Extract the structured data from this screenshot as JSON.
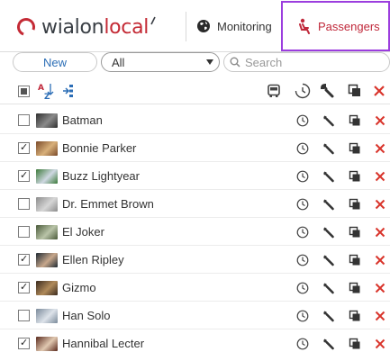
{
  "header": {
    "logo_prefix": "wialon",
    "logo_suffix": "local",
    "nav": [
      {
        "label": "Monitoring",
        "icon": "globe-icon"
      },
      {
        "label": "Passengers",
        "icon": "passenger-seat-icon",
        "active": true
      }
    ]
  },
  "toolbar": {
    "new_label": "New",
    "filter_value": "All",
    "search_placeholder": "Search"
  },
  "list_header": {
    "icons": [
      "select-all-checkbox",
      "sort-az-icon",
      "tree-view-icon",
      "bus-icon",
      "clock-history-icon",
      "wrench-icon",
      "copy-icon",
      "delete-icon"
    ]
  },
  "passengers": [
    {
      "name": "Batman",
      "checked": false,
      "avatar": [
        "#2f2f2f",
        "#8a8a8a"
      ]
    },
    {
      "name": "Bonnie Parker",
      "checked": true,
      "avatar": [
        "#7a4a2a",
        "#d8b07a"
      ]
    },
    {
      "name": "Buzz Lightyear",
      "checked": true,
      "avatar": [
        "#3c7a3a",
        "#cfd8e2"
      ]
    },
    {
      "name": "Dr. Emmet Brown",
      "checked": false,
      "avatar": [
        "#8c8c8c",
        "#d6d6d6"
      ]
    },
    {
      "name": "El Joker",
      "checked": false,
      "avatar": [
        "#4a5a3a",
        "#b9c4a8"
      ]
    },
    {
      "name": "Ellen Ripley",
      "checked": true,
      "avatar": [
        "#1f2a33",
        "#c8a88c"
      ]
    },
    {
      "name": "Gizmo",
      "checked": true,
      "avatar": [
        "#3a2a1e",
        "#b08a5a"
      ]
    },
    {
      "name": "Han Solo",
      "checked": false,
      "avatar": [
        "#7a8a9a",
        "#dde3ea"
      ]
    },
    {
      "name": "Hannibal Lecter",
      "checked": true,
      "avatar": [
        "#5a2a1e",
        "#e0c8b0"
      ]
    }
  ],
  "colors": {
    "accent_red": "#d9342b",
    "active_outline": "#9b3dde",
    "link_blue": "#2c6eb6"
  }
}
